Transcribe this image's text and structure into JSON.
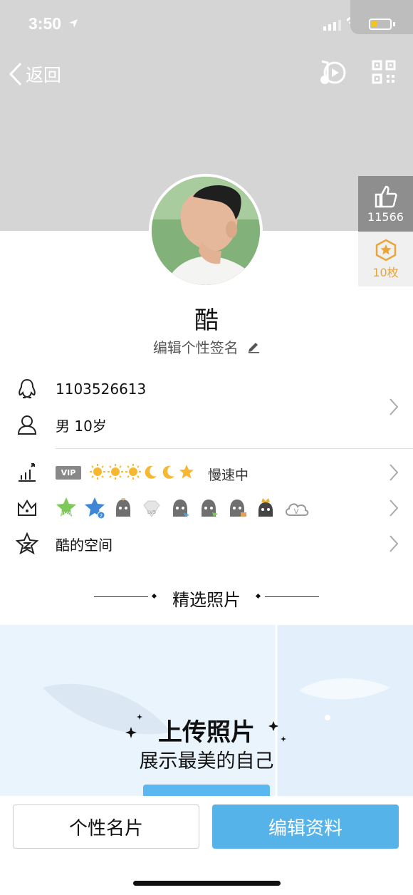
{
  "status": {
    "time": "3:50"
  },
  "nav": {
    "back_label": "返回"
  },
  "side": {
    "likes": "11566",
    "badges": "10枚"
  },
  "profile": {
    "name": "酷",
    "signature": "编辑个性签名"
  },
  "info": {
    "qq": "1103526613",
    "gender_age": "男 10岁"
  },
  "level": {
    "vip": "VIP",
    "speed": "慢速中"
  },
  "medals": [
    "LV4",
    "2",
    "",
    "LV5",
    "",
    "",
    "",
    "",
    "V"
  ],
  "space": {
    "label": "酷的空间"
  },
  "photos": {
    "title": "精选照片",
    "upload_title": "上传照片",
    "upload_subtitle": "展示最美的自己"
  },
  "bottom": {
    "card_button": "个性名片",
    "edit_button": "编辑资料"
  },
  "colors": {
    "header_bg": "#d5d5d5",
    "accent": "#55b3ea",
    "gold": "#e9a53a"
  }
}
